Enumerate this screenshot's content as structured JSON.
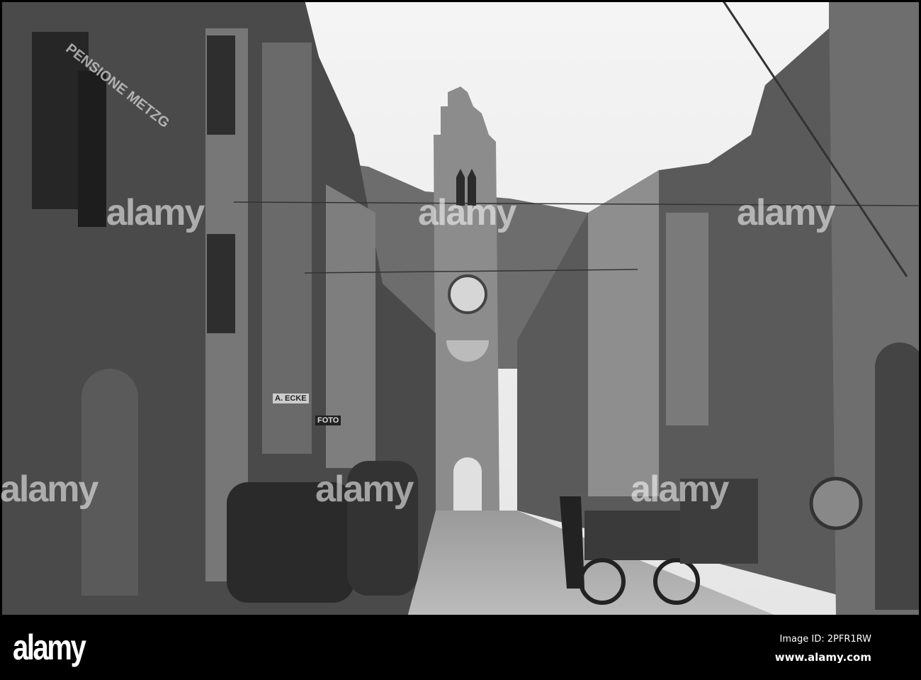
{
  "photo": {
    "signs": {
      "pensione": "PENSIONE METZG",
      "shop": "A. ECKE",
      "foto": "FOTO"
    },
    "watermark": "alamy"
  },
  "footer": {
    "logo": "alamy",
    "image_id": "Image ID: 2PFR1RW",
    "url": "www.alamy.com"
  }
}
